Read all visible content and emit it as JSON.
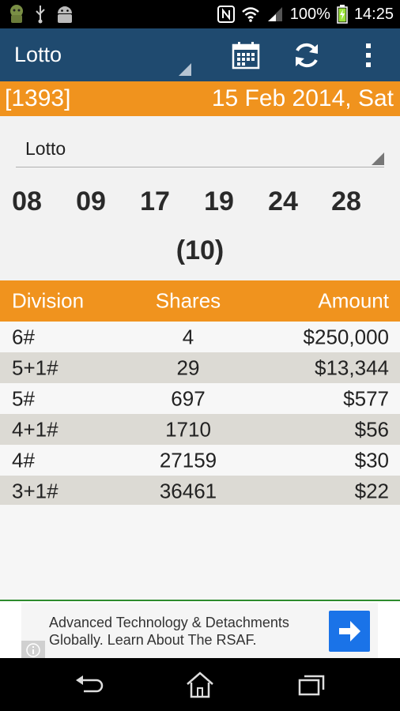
{
  "status_bar": {
    "battery": "100%",
    "time": "14:25"
  },
  "action_bar": {
    "title": "Lotto",
    "icons": [
      "calendar-icon",
      "refresh-icon",
      "overflow-menu-icon"
    ]
  },
  "draw": {
    "number": "[1393]",
    "date": "15 Feb 2014, Sat"
  },
  "game_select": {
    "value": "Lotto"
  },
  "results": {
    "numbers": [
      "08",
      "09",
      "17",
      "19",
      "24",
      "28"
    ],
    "bonus": "(10)"
  },
  "table": {
    "headers": {
      "division": "Division",
      "shares": "Shares",
      "amount": "Amount"
    },
    "rows": [
      {
        "division": "6#",
        "shares": "4",
        "amount": "$250,000"
      },
      {
        "division": "5+1#",
        "shares": "29",
        "amount": "$13,344"
      },
      {
        "division": "5#",
        "shares": "697",
        "amount": "$577"
      },
      {
        "division": "4+1#",
        "shares": "1710",
        "amount": "$56"
      },
      {
        "division": "4#",
        "shares": "27159",
        "amount": "$30"
      },
      {
        "division": "3+1#",
        "shares": "36461",
        "amount": "$22"
      }
    ]
  },
  "ad": {
    "text": "Advanced Technology & Detachments Globally. Learn About The RSAF."
  },
  "colors": {
    "action_bar": "#1f4a6f",
    "accent_orange": "#f0931e",
    "row_alt": "#dcdad4"
  }
}
